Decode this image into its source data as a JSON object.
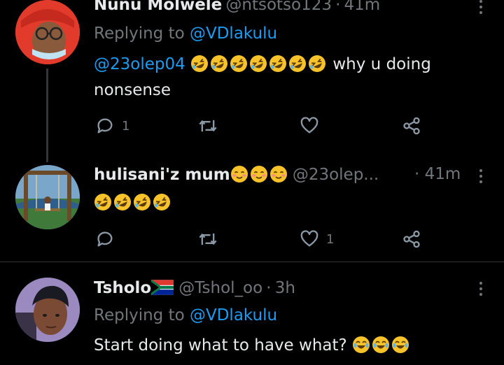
{
  "tweets": [
    {
      "display_name": "Nunu Molwele",
      "handle": "@ntsotso123",
      "separator": "·",
      "time": "41m",
      "replying_label": "Replying to",
      "replying_to": "@VDlakulu",
      "mention": "@23olep04",
      "text_after_emoji": "why u doing",
      "text_line2": "nonsense",
      "reply_count": "1",
      "retweet_count": "",
      "like_count": ""
    },
    {
      "display_name": "hulisani'z mum",
      "handle": "@23olep...",
      "separator": "·",
      "time": "41m",
      "reply_count": "",
      "retweet_count": "",
      "like_count": "1"
    },
    {
      "display_name": "Tsholo",
      "handle": "@Tshol_oo",
      "separator": "·",
      "time": "3h",
      "replying_label": "Replying to",
      "replying_to": "@VDlakulu",
      "text": "Start doing what to have what?"
    }
  ],
  "colors": {
    "background": "#000000",
    "text": "#e7e9ea",
    "muted": "#71767b",
    "link": "#1d9bf0",
    "divider": "#2f3336"
  },
  "icons": [
    "reply-icon",
    "retweet-icon",
    "like-icon",
    "share-icon",
    "more-icon",
    "rofl-emoji",
    "smiling-blush-emoji",
    "joy-emoji",
    "south-africa-flag"
  ]
}
